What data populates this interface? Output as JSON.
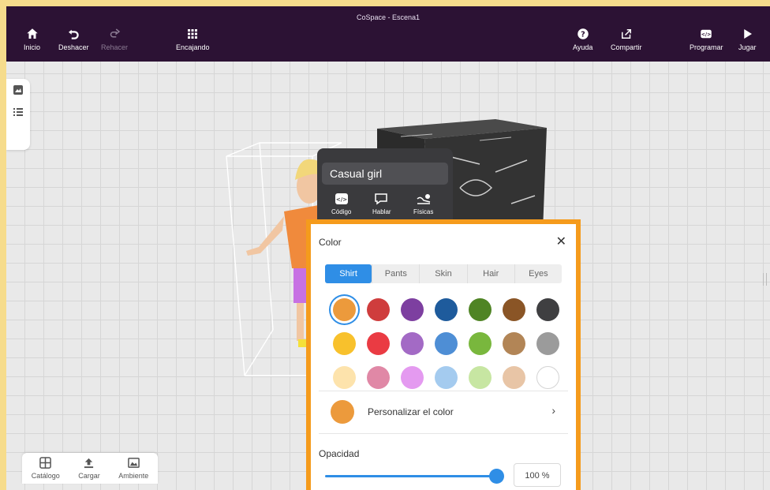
{
  "window": {
    "title": "CoSpace - Escena1"
  },
  "toolbar": {
    "home": "Inicio",
    "undo": "Deshacer",
    "redo": "Rehacer",
    "snap": "Encajando",
    "help": "Ayuda",
    "share": "Compartir",
    "code": "Programar",
    "play": "Jugar"
  },
  "bottom_tabs": {
    "catalog": "Catálogo",
    "upload": "Cargar",
    "environment": "Ambiente"
  },
  "object_panel": {
    "name": "Casual girl",
    "actions": {
      "code": "Código",
      "speak": "Hablar",
      "physics": "Físicas"
    }
  },
  "color_dialog": {
    "title": "Color",
    "close": "✕",
    "tabs": [
      "Shirt",
      "Pants",
      "Skin",
      "Hair",
      "Eyes"
    ],
    "active_tab": "Shirt",
    "swatches": [
      [
        "#ec9a3c",
        "#cf3d3d",
        "#7d3fa0",
        "#1e5b9c",
        "#4f8424",
        "#8a5526",
        "#3f3f41"
      ],
      [
        "#f8c12c",
        "#ea3b43",
        "#a36ac5",
        "#4e8ed5",
        "#79b73d",
        "#b28556",
        "#9b9b9b"
      ],
      [
        "#fde3ac",
        "#e088a6",
        "#e49af0",
        "#a4cbef",
        "#c7e6a2",
        "#e8c5a6",
        "#ffffff"
      ]
    ],
    "selected_swatch": "#ec9a3c",
    "custom": {
      "label": "Personalizar el color",
      "color": "#ec9a3c",
      "chevron": "›"
    },
    "opacity": {
      "label": "Opacidad",
      "value": 100,
      "display": "100 %"
    }
  },
  "colors": {
    "topbar": "#2c1234",
    "accent": "#2f8ee6",
    "highlight": "#f59b1c"
  }
}
